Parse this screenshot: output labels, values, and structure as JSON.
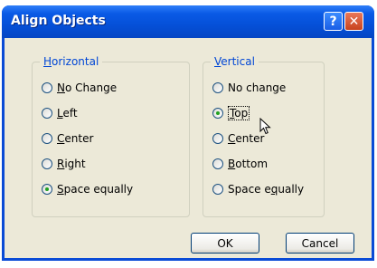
{
  "window": {
    "title": "Align Objects"
  },
  "titlebar_buttons": {
    "help": "?",
    "close": "✕"
  },
  "horizontal": {
    "legend_pre": "",
    "legend_key": "H",
    "legend_rest": "orizontal",
    "options": [
      {
        "key": "N",
        "rest": "o Change",
        "pre": ""
      },
      {
        "key": "L",
        "rest": "eft",
        "pre": ""
      },
      {
        "key": "C",
        "rest": "enter",
        "pre": ""
      },
      {
        "key": "R",
        "rest": "ight",
        "pre": ""
      },
      {
        "key": "S",
        "rest": "pace equally",
        "pre": ""
      }
    ],
    "selected_index": 4
  },
  "vertical": {
    "legend_pre": "",
    "legend_key": "V",
    "legend_rest": "ertical",
    "options": [
      {
        "pre": "No change",
        "key": "",
        "rest": ""
      },
      {
        "pre": "",
        "key": "T",
        "rest": "op"
      },
      {
        "pre": "",
        "key": "C",
        "rest": "enter"
      },
      {
        "pre": "",
        "key": "B",
        "rest": "ottom"
      },
      {
        "pre": "Space e",
        "key": "q",
        "rest": "ually"
      }
    ],
    "selected_index": 1
  },
  "buttons": {
    "ok": "OK",
    "cancel": "Cancel"
  }
}
